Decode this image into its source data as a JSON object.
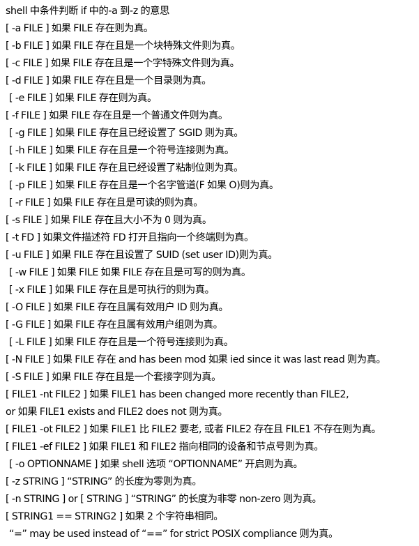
{
  "document": {
    "title": "shell 中条件判断 if 中的-a 到-z 的意思",
    "lines": [
      "[ -a FILE ] 如果 FILE 存在则为真。",
      "[ -b FILE ] 如果 FILE 存在且是一个块特殊文件则为真。",
      "[ -c FILE ] 如果 FILE 存在且是一个字特殊文件则为真。",
      "[ -d FILE ] 如果 FILE 存在且是一个目录则为真。",
      "[ -e FILE ] 如果 FILE 存在则为真。",
      "[ -f FILE ] 如果 FILE 存在且是一个普通文件则为真。",
      "[ -g FILE ] 如果 FILE 存在且已经设置了 SGID 则为真。",
      "[ -h FILE ] 如果 FILE 存在且是一个符号连接则为真。",
      "[ -k FILE ] 如果 FILE 存在且已经设置了粘制位则为真。",
      "[ -p FILE ] 如果 FILE 存在且是一个名字管道(F 如果 O)则为真。",
      "[ -r FILE ] 如果 FILE 存在且是可读的则为真。",
      "[ -s FILE ] 如果 FILE 存在且大小不为 0 则为真。",
      "[ -t FD ] 如果文件描述符 FD 打开且指向一个终端则为真。",
      "[ -u FILE ] 如果 FILE 存在且设置了 SUID (set user ID)则为真。",
      "[ -w FILE ] 如果 FILE 如果 FILE 存在且是可写的则为真。",
      "[ -x FILE ] 如果 FILE 存在且是可执行的则为真。",
      "[ -O FILE ] 如果 FILE 存在且属有效用户 ID 则为真。",
      "[ -G FILE ] 如果 FILE 存在且属有效用户组则为真。",
      "[ -L FILE ] 如果 FILE 存在且是一个符号连接则为真。",
      "[ -N FILE ] 如果 FILE 存在 and has been mod 如果 ied since it was last read 则为真。",
      "[ -S FILE ] 如果 FILE 存在且是一个套接字则为真。",
      "[ FILE1 -nt FILE2 ] 如果 FILE1 has been changed more recently than FILE2,",
      "or 如果 FILE1 exists and FILE2 does not 则为真。",
      "[ FILE1 -ot FILE2 ] 如果 FILE1 比 FILE2 要老, 或者 FILE2 存在且 FILE1 不存在则为真。",
      "[ FILE1 -ef FILE2 ] 如果 FILE1 和 FILE2 指向相同的设备和节点号则为真。",
      "[ -o OPTIONNAME ] 如果 shell 选项 “OPTIONNAME” 开启则为真。",
      "[ -z STRING ] “STRING” 的长度为零则为真。",
      "[ -n STRING ] or [ STRING ] “STRING” 的长度为非零 non-zero 则为真。",
      "[ STRING1 == STRING2 ] 如果 2 个字符串相同。",
      "“=” may be used instead of “==” for strict POSIX compliance 则为真。"
    ]
  }
}
